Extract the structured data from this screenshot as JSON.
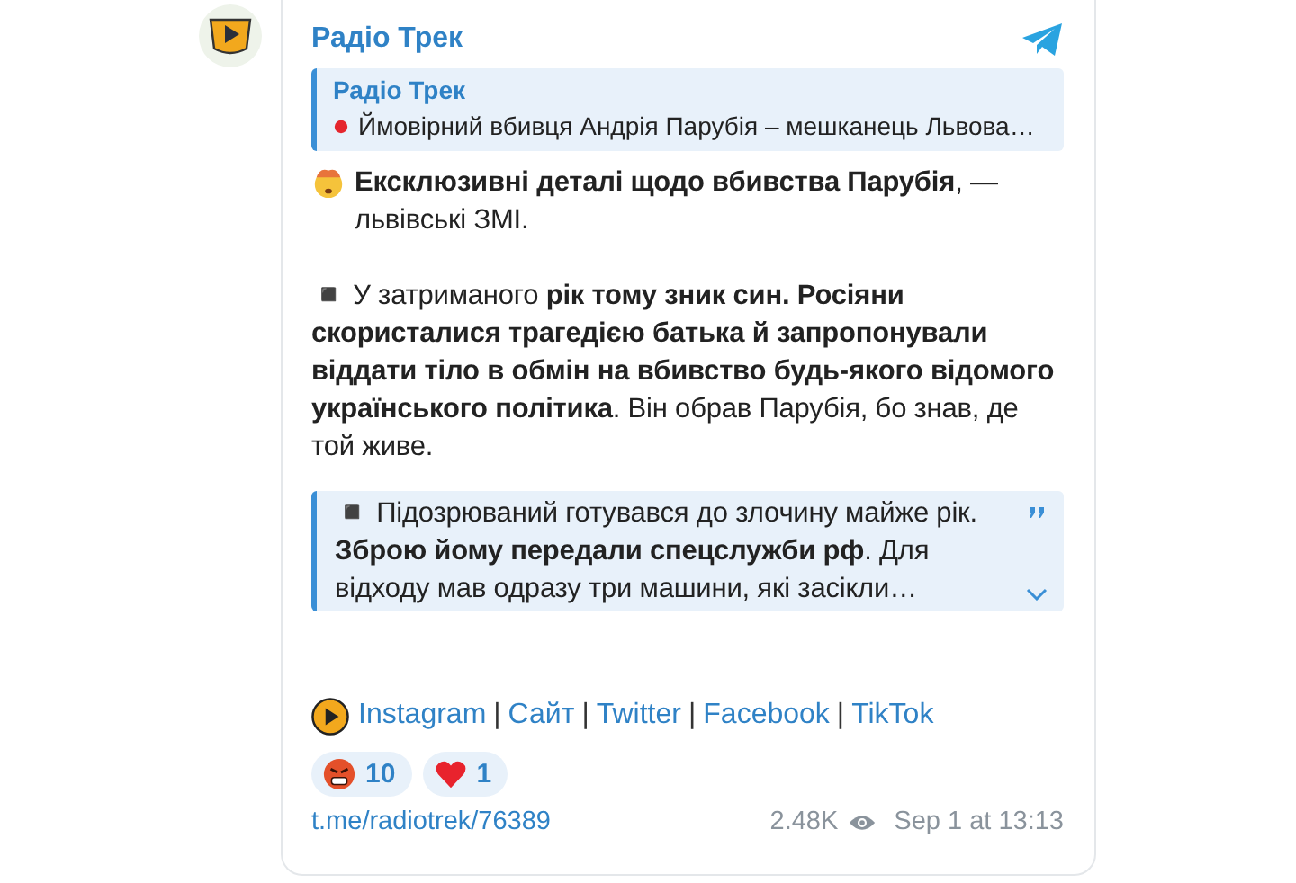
{
  "channel": {
    "name": "Радіо Трек"
  },
  "reply": {
    "author": "Радіо Трек",
    "text": "Ймовірний вбивця Андрія Парубія – мешканець Львова…"
  },
  "paragraphs": [
    {
      "kind": "emoji-lead",
      "text": "**Ексклюзивні деталі щодо вбивства Парубія**, — львівські ЗМІ."
    },
    {
      "text": "◾ У затриманого **рік тому зник син. Росіяни скористалися трагедією батька й запропонували віддати тіло в обмін на вбивство будь-якого відомого українського політика**. Він обрав Парубія, бо знав, де той живе."
    }
  ],
  "quote": {
    "text": "◾ Підозрюваний готувався до злочину майже рік. **Зброю йому передали спецслужби рф**. Для відходу мав одразу три машини, які засікли…",
    "expanded": false
  },
  "links": {
    "separator": "|",
    "items": [
      "Instagram",
      "Сайт",
      "Twitter",
      "Facebook",
      "TikTok"
    ]
  },
  "reactions": [
    {
      "kind": "angry",
      "count": "10"
    },
    {
      "kind": "heart",
      "count": "1"
    }
  ],
  "footer": {
    "link": "t.me/radiotrek/76389",
    "views": "2.48K",
    "date": "Sep 1 at 13:13"
  }
}
